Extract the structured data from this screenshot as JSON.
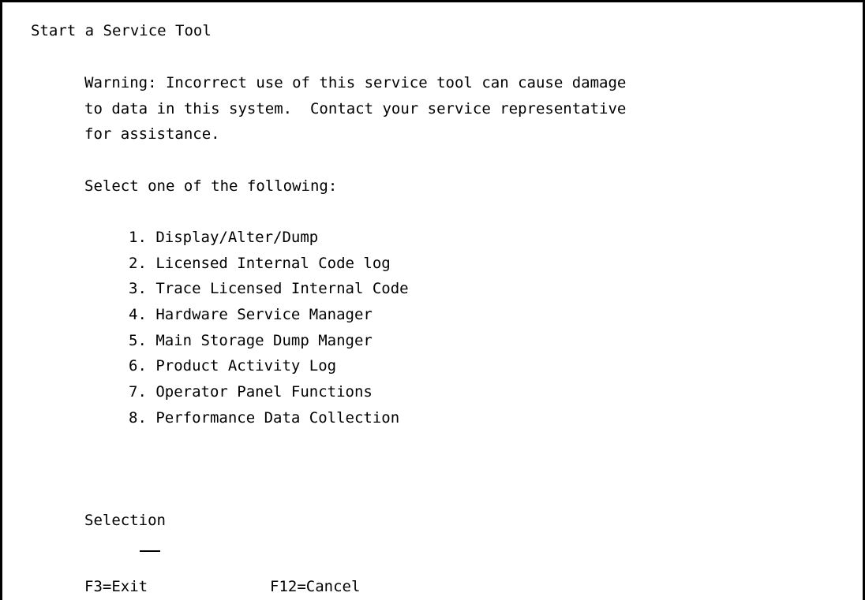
{
  "screen": {
    "title": "Start a Service Tool",
    "warning_lines": [
      "Warning: Incorrect use of this service tool can cause damage",
      "to data in this system.  Contact your service representative",
      "for assistance."
    ],
    "instruction": "Select one of the following:",
    "options": [
      "1. Display/Alter/Dump",
      "2. Licensed Internal Code log",
      "3. Trace Licensed Internal Code",
      "4. Hardware Service Manager",
      "5. Main Storage Dump Manger",
      "6. Product Activity Log",
      "7. Operator Panel Functions",
      "8. Performance Data Collection"
    ],
    "selection_label": "Selection",
    "selection_value": "",
    "function_keys": [
      "F3=Exit",
      "F12=Cancel"
    ]
  }
}
